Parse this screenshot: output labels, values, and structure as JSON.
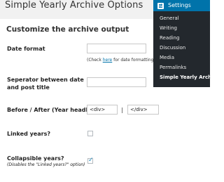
{
  "page": {
    "title": "Simple Yearly Archive Options"
  },
  "form": {
    "section_heading": "Customize the archive output",
    "date_format": {
      "label": "Date format",
      "value": "",
      "help_prefix": "(Check ",
      "help_link": "here",
      "help_suffix": " for date formatting)"
    },
    "separator": {
      "label": "Seperator between date and post title",
      "value": ""
    },
    "before_after": {
      "label": "Before / After (Year headline)",
      "before_value": "<div>",
      "separator": "|",
      "after_value": "</div>"
    },
    "linked_years": {
      "label": "Linked years?",
      "checked": false
    },
    "collapsible_years": {
      "label": "Collapsible years?",
      "note": "(Disables the \"Linked years?\" option)",
      "checked": true,
      "check_glyph": "✓"
    }
  },
  "admin_menu": {
    "header_label": "Settings",
    "header_icon": "settings-sliders-icon",
    "header_color": "#0073aa",
    "background_color": "#23282d",
    "items": [
      {
        "label": "General"
      },
      {
        "label": "Writing"
      },
      {
        "label": "Reading"
      },
      {
        "label": "Discussion"
      },
      {
        "label": "Media"
      },
      {
        "label": "Permalinks"
      },
      {
        "label": "Simple Yearly Archive",
        "current": true
      }
    ]
  }
}
